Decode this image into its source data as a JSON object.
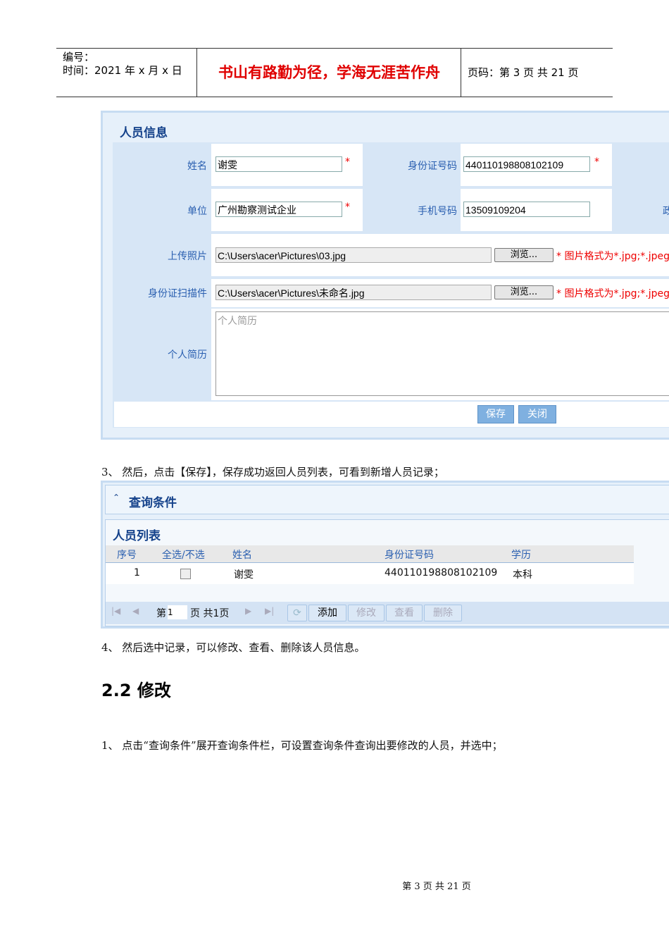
{
  "header": {
    "number_label": "编号：",
    "time_label": "时间：2021 年 x 月 x 日",
    "motto": "书山有路勤为径，学海无涯苦作舟",
    "page_info": "页码：第 3 页  共 21 页"
  },
  "form": {
    "title": "人员信息",
    "name_label": "姓名",
    "name_value": "谢雯",
    "id_label": "身份证号码",
    "id_value": "440110198808102109",
    "unit_label": "单位",
    "unit_value": "广州勘察测试企业",
    "phone_label": "手机号码",
    "phone_value": "13509109204",
    "cut_label": "政",
    "photo_label": "上传照片",
    "photo_value": "C:\\Users\\acer\\Pictures\\03.jpg",
    "scan_label": "身份证扫描件",
    "scan_value": "C:\\Users\\acer\\Pictures\\未命名.jpg",
    "browse_label": "浏览...",
    "format_hint": "图片格式为*.jpg;*.jpeg",
    "resume_label": "个人简历",
    "resume_placeholder": "个人简历",
    "required_mark": "*",
    "save_label": "保存",
    "close_label": "关闭"
  },
  "step3": "3、 然后，点击【保存】，保存成功返回人员列表，可看到新增人员记录；",
  "query": {
    "title": "查询条件"
  },
  "list": {
    "title": "人员列表",
    "columns": [
      "序号",
      "全选/不选",
      "姓名",
      "身份证号码",
      "学历"
    ],
    "rows": [
      {
        "no": "1",
        "name": "谢雯",
        "id": "440110198808102109",
        "edu": "本科"
      }
    ],
    "pager": {
      "page_prefix": "第",
      "page_value": "1",
      "page_suffix": "页 共1页"
    },
    "buttons": {
      "add": "添加",
      "edit": "修改",
      "view": "查看",
      "delete": "删除"
    }
  },
  "step4": "4、 然后选中记录，可以修改、查看、删除该人员信息。",
  "section": "2.2 修改",
  "step1": "1、 点击“查询条件”展开查询条件栏，可设置查询条件查询出要修改的人员，并选中；",
  "footer": "第 3 页 共 21 页"
}
